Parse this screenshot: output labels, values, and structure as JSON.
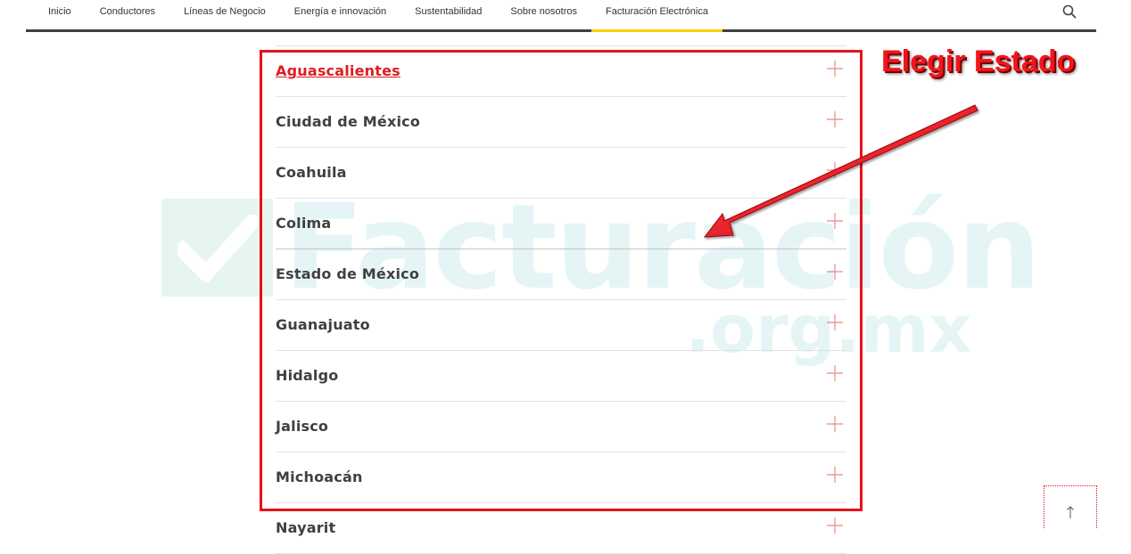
{
  "nav": {
    "items": [
      {
        "label": "Inicio"
      },
      {
        "label": "Conductores"
      },
      {
        "label": "Líneas de Negocio"
      },
      {
        "label": "Energía e innovación"
      },
      {
        "label": "Sustentabilidad"
      },
      {
        "label": "Sobre nosotros"
      },
      {
        "label": "Facturación Electrónica",
        "active": true
      }
    ],
    "search_icon": "search-icon",
    "active_color": "#fbce07"
  },
  "watermark": {
    "main": "Facturación",
    "sub": ".org.mx",
    "icon": "check-icon"
  },
  "states": [
    {
      "label": "Aguascalientes",
      "selected": true
    },
    {
      "label": "Ciudad de México"
    },
    {
      "label": "Coahuila"
    },
    {
      "label": "Colima"
    },
    {
      "label": "Estado de México"
    },
    {
      "label": "Guanajuato"
    },
    {
      "label": "Hidalgo"
    },
    {
      "label": "Jalisco"
    },
    {
      "label": "Michoacán"
    },
    {
      "label": "Nayarit"
    }
  ],
  "annotation": {
    "text": "Elegir Estado",
    "color": "#f2141c"
  },
  "colors": {
    "selected_link": "#dd1d21",
    "plus_icon": "#e58a8c",
    "text": "#404040"
  },
  "back_to_top_icon": "arrow-up-icon"
}
